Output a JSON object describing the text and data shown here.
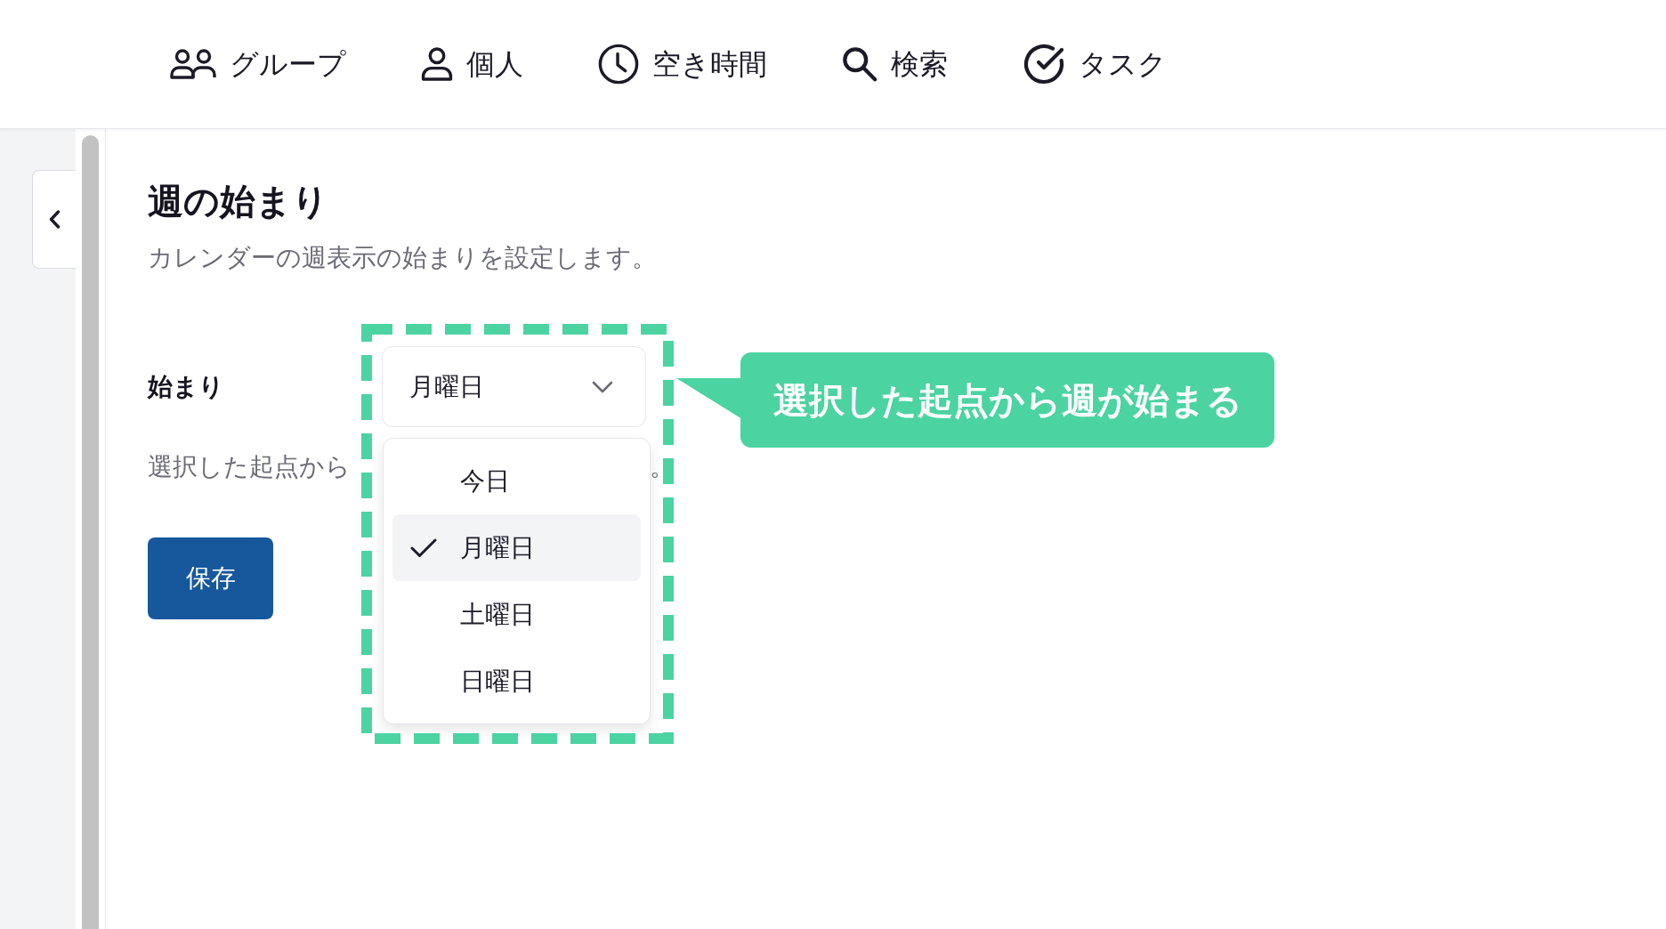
{
  "nav": [
    {
      "label": "グループ"
    },
    {
      "label": "個人"
    },
    {
      "label": "空き時間"
    },
    {
      "label": "検索"
    },
    {
      "label": "タスク"
    }
  ],
  "page": {
    "title": "週の始まり",
    "description": "カレンダーの週表示の始まりを設定します。"
  },
  "setting": {
    "label": "始まり",
    "select": {
      "value": "月曜日",
      "expanded": true,
      "options": [
        {
          "label": "今日",
          "selected": false
        },
        {
          "label": "月曜日",
          "selected": true
        },
        {
          "label": "土曜日",
          "selected": false
        },
        {
          "label": "日曜日",
          "selected": false
        }
      ]
    },
    "hint_parts": [
      "選択した起点から",
      "。"
    ]
  },
  "save_button": "保存",
  "annotation": {
    "text": "選択した起点から週が始まる"
  }
}
